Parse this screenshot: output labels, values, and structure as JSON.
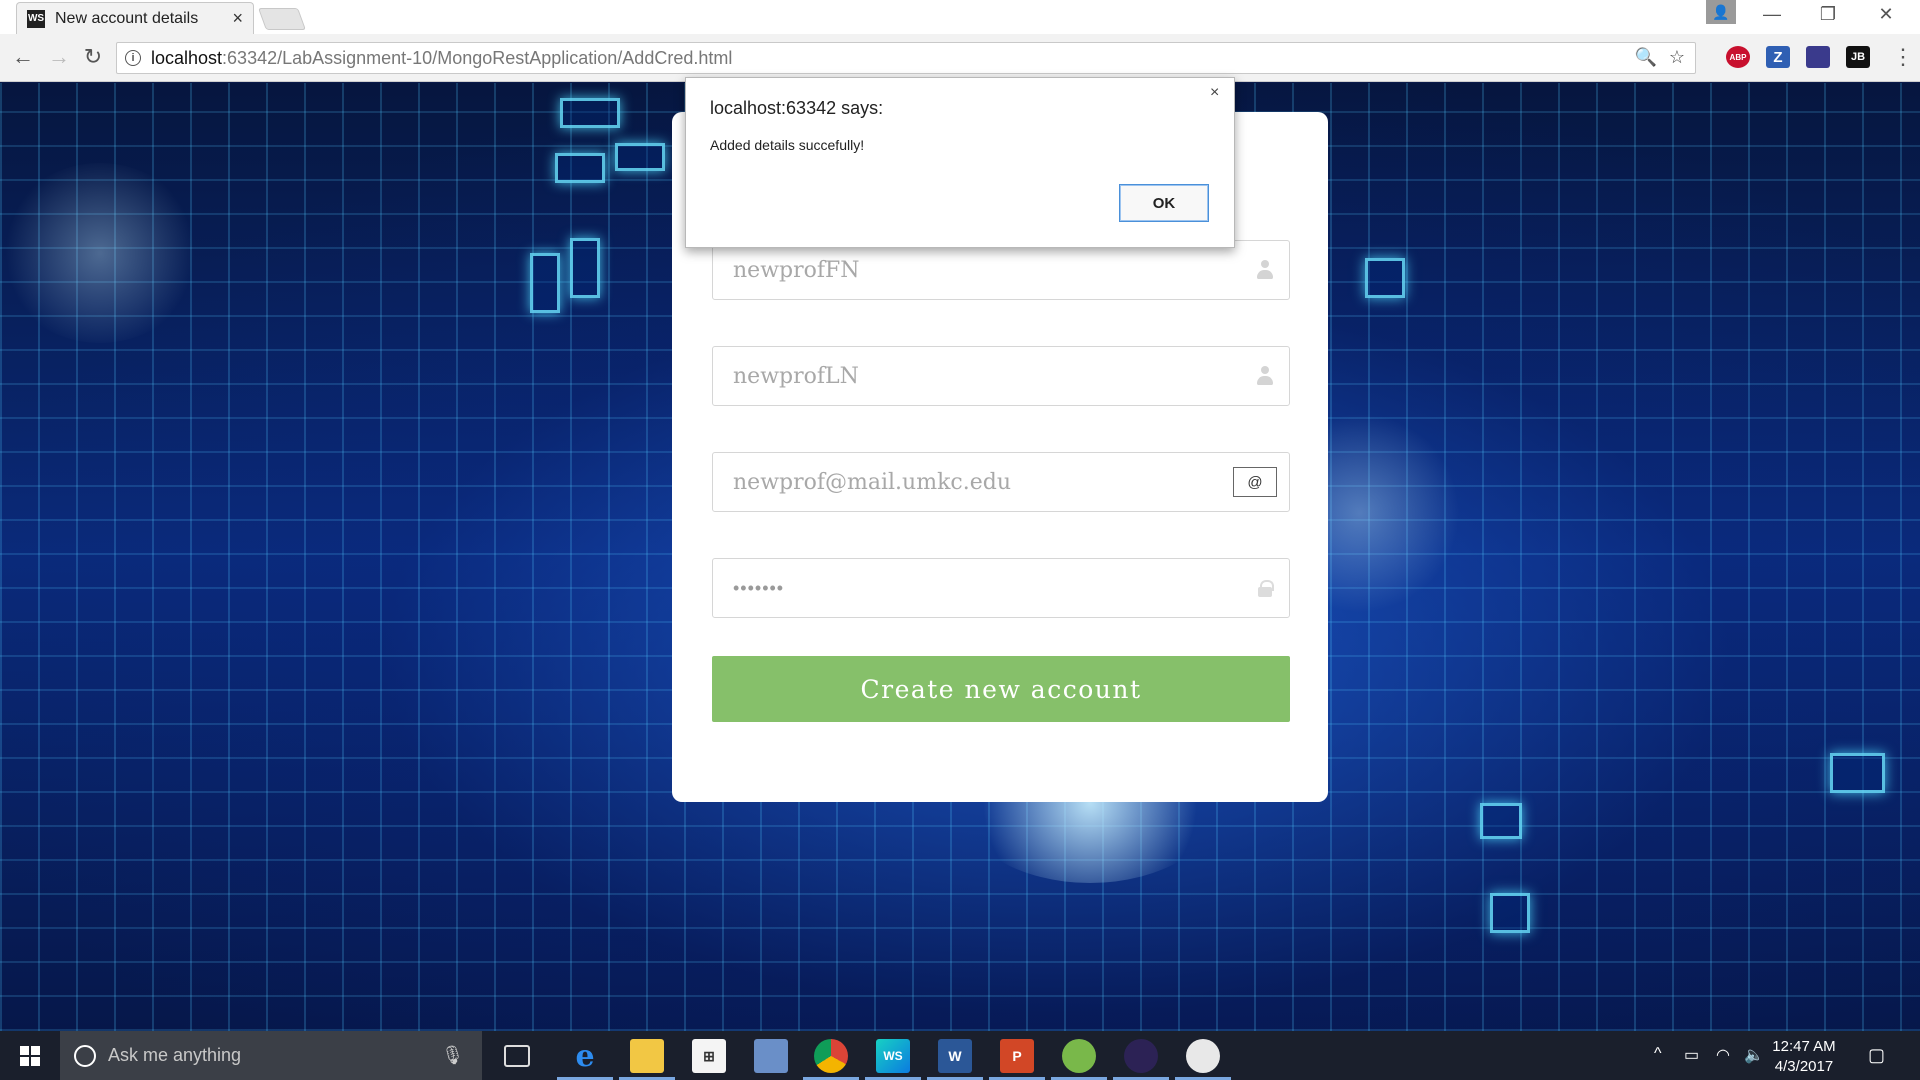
{
  "browser": {
    "tab_title": "New account details",
    "tab_favicon": "WS",
    "url_host": "localhost",
    "url_rest": ":63342/LabAssignment-10/MongoRestApplication/AddCred.html",
    "extensions": [
      "ABP",
      "Z",
      "JB"
    ],
    "extension_icons": [
      "adblock-plus-icon",
      "zotero-icon",
      "pocket-icon",
      "jetbrains-icon"
    ]
  },
  "form": {
    "first_name": "newprofFN",
    "last_name": "newprofLN",
    "email": "newprof@mail.umkc.edu",
    "password_mask": "•••••••",
    "email_icon_glyph": "@",
    "submit_label": "Create new account",
    "accent_color": "#86c06a"
  },
  "dialog": {
    "title": "localhost:63342 says:",
    "message": "Added details succefully!",
    "ok_label": "OK",
    "close_glyph": "×"
  },
  "taskbar": {
    "search_placeholder": "Ask me anything",
    "time": "12:47 AM",
    "date": "4/3/2017",
    "apps": [
      "task-view",
      "edge",
      "file-explorer",
      "store",
      "remote-desktop",
      "chrome",
      "webstorm",
      "word",
      "powerpoint",
      "android-studio",
      "eclipse",
      "paint"
    ]
  }
}
